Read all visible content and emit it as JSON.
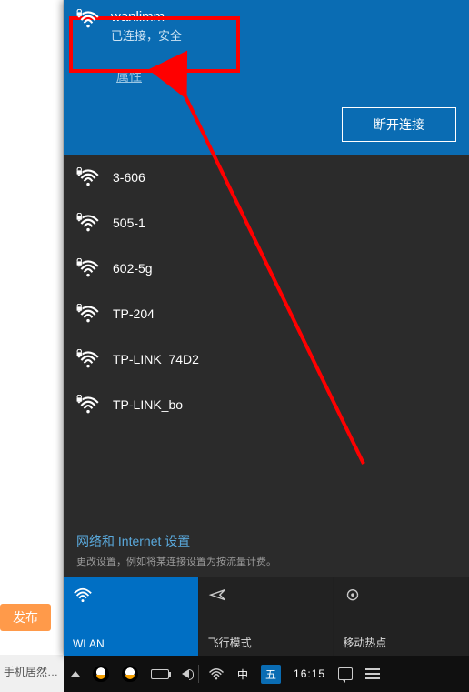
{
  "annotation": {
    "highlight_target": "connected-network",
    "arrow_color": "#ff0000"
  },
  "connected": {
    "ssid": "wanlimm",
    "status": "已连接，安全",
    "properties_label": "属性",
    "disconnect_label": "断开连接"
  },
  "networks": [
    {
      "ssid": "3-606",
      "secured": true
    },
    {
      "ssid": "505-1",
      "secured": true
    },
    {
      "ssid": "602-5g",
      "secured": true
    },
    {
      "ssid": "TP-204",
      "secured": true
    },
    {
      "ssid": "TP-LINK_74D2",
      "secured": true
    },
    {
      "ssid": "TP-LINK_bo",
      "secured": true
    }
  ],
  "settings": {
    "link": "网络和 Internet 设置",
    "sub": "更改设置，例如将某连接设置为按流量计费。"
  },
  "tiles": {
    "wlan": "WLAN",
    "airplane": "飞行模式",
    "hotspot": "移动热点"
  },
  "taskbar": {
    "ime_lang": "中",
    "ime_day": "五",
    "time": "16:15"
  },
  "page": {
    "publish": "发布",
    "bottom_snippet": "手机居然…"
  }
}
